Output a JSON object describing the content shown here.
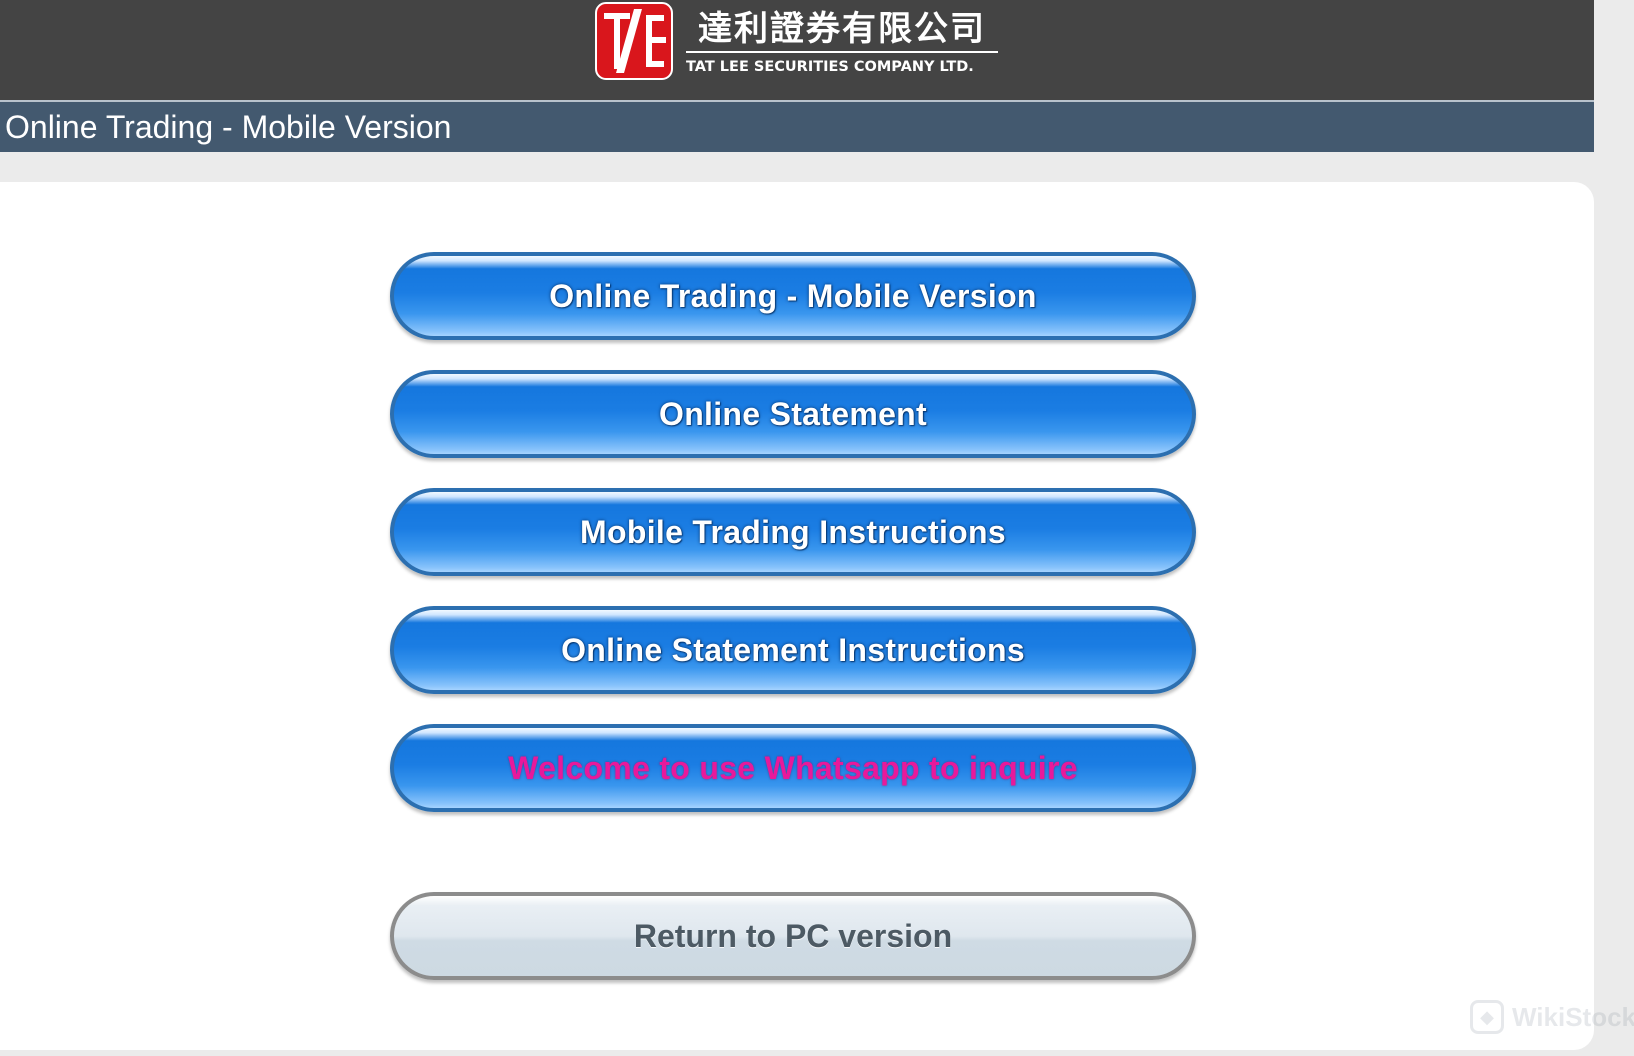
{
  "header": {
    "logo_cn": "達利證券有限公司",
    "logo_en": "TAT LEE SECURITIES COMPANY LTD."
  },
  "title_bar": {
    "title": "Online Trading - Mobile Version"
  },
  "menu": {
    "items": [
      {
        "label": "Online Trading - Mobile Version"
      },
      {
        "label": "Online Statement"
      },
      {
        "label": "Mobile Trading Instructions"
      },
      {
        "label": "Online Statement Instructions"
      },
      {
        "label": "Welcome to use Whatsapp to inquire"
      }
    ],
    "return_label": "Return to PC version"
  },
  "watermark": {
    "text": "WikiStock"
  },
  "colors": {
    "header_bg": "#444444",
    "title_bar_bg": "#43596f",
    "button_blue": "#1b7de3",
    "whatsapp_text": "#e8199b",
    "logo_red": "#d9161c"
  },
  "icons": {
    "logo": "tat-lee-logo-icon",
    "watermark": "wikistock-icon"
  }
}
